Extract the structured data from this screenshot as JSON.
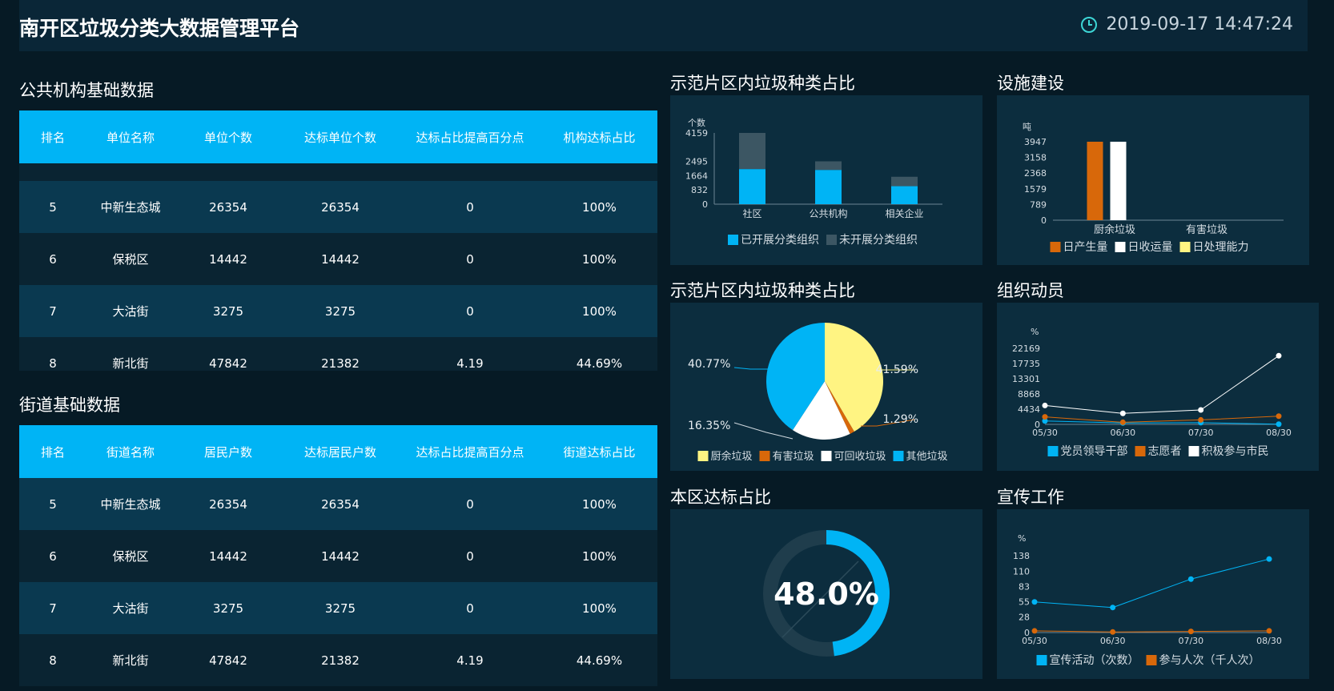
{
  "header": {
    "title": "南开区垃圾分类大数据管理平台",
    "datetime": "2019-09-17 14:47:24"
  },
  "org_table": {
    "title": "公共机构基础数据",
    "columns": [
      "排名",
      "单位名称",
      "单位个数",
      "达标单位个数",
      "达标占比提高百分点",
      "机构达标占比"
    ],
    "rows": [
      [
        "5",
        "中新生态城",
        "26354",
        "26354",
        "0",
        "100%"
      ],
      [
        "6",
        "保税区",
        "14442",
        "14442",
        "0",
        "100%"
      ],
      [
        "7",
        "大沽街",
        "3275",
        "3275",
        "0",
        "100%"
      ],
      [
        "8",
        "新北街",
        "47842",
        "21382",
        "4.19",
        "44.69%"
      ]
    ]
  },
  "street_table": {
    "title": "街道基础数据",
    "columns": [
      "排名",
      "街道名称",
      "居民户数",
      "达标居民户数",
      "达标占比提高百分点",
      "街道达标占比"
    ],
    "rows": [
      [
        "5",
        "中新生态城",
        "26354",
        "26354",
        "0",
        "100%"
      ],
      [
        "6",
        "保税区",
        "14442",
        "14442",
        "0",
        "100%"
      ],
      [
        "7",
        "大沽街",
        "3275",
        "3275",
        "0",
        "100%"
      ],
      [
        "8",
        "新北街",
        "47842",
        "21382",
        "4.19",
        "44.69%"
      ]
    ]
  },
  "panels": {
    "bar1_title": "示范片区内垃圾种类占比",
    "bar2_title": "设施建设",
    "pie_title": "示范片区内垃圾种类占比",
    "line1_title": "组织动员",
    "donut_title": "本区达标占比",
    "line2_title": "宣传工作"
  },
  "colors": {
    "cyan": "#00b4f5",
    "orange": "#d8680a",
    "white": "#ffffff",
    "yellow": "#fff482",
    "gray": "#3c5663"
  },
  "chart_data": [
    {
      "id": "bar1",
      "type": "bar",
      "categories": [
        "社区",
        "公共机构",
        "相关企业"
      ],
      "ylabel": "个数",
      "yticks": [
        "0",
        "832",
        "1664",
        "2495",
        "4159"
      ],
      "ylim": [
        0,
        4159
      ],
      "series": [
        {
          "name": "已开展分类组织",
          "values": [
            2050,
            2000,
            1050
          ]
        },
        {
          "name": "未开展分类组织",
          "values": [
            2109,
            500,
            550
          ]
        }
      ],
      "stacked": true
    },
    {
      "id": "bar2",
      "type": "bar",
      "categories": [
        "厨余垃圾",
        "有害垃圾"
      ],
      "ylabel": "吨",
      "yticks": [
        "0",
        "789",
        "1579",
        "2368",
        "3158",
        "3947"
      ],
      "ylim": [
        0,
        3947
      ],
      "series": [
        {
          "name": "日产生量",
          "values": [
            3947,
            0
          ]
        },
        {
          "name": "日收运量",
          "values": [
            3947,
            0
          ]
        },
        {
          "name": "日处理能力",
          "values": [
            0,
            0
          ]
        }
      ]
    },
    {
      "id": "pie",
      "type": "pie",
      "slices": [
        {
          "name": "厨余垃圾",
          "value": 41.59,
          "label": "41.59%"
        },
        {
          "name": "有害垃圾",
          "value": 1.29,
          "label": "1.29%"
        },
        {
          "name": "可回收垃圾",
          "value": 16.35,
          "label": "16.35%"
        },
        {
          "name": "其他垃圾",
          "value": 40.77,
          "label": "40.77%"
        }
      ]
    },
    {
      "id": "line1",
      "type": "line",
      "categories": [
        "05/30",
        "06/30",
        "07/30",
        "08/30"
      ],
      "ylabel": "%",
      "yticks": [
        "0",
        "4434",
        "8868",
        "13301",
        "17735",
        "22169"
      ],
      "ylim": [
        0,
        22169
      ],
      "series": [
        {
          "name": "党员领导干部",
          "values": [
            1000,
            400,
            500,
            50
          ]
        },
        {
          "name": "志愿者",
          "values": [
            2200,
            600,
            1300,
            2400
          ]
        },
        {
          "name": "积极参与市民",
          "values": [
            5500,
            3200,
            4200,
            20000
          ]
        }
      ]
    },
    {
      "id": "donut",
      "type": "pie",
      "value": 48.0,
      "label": "48.0%"
    },
    {
      "id": "line2",
      "type": "line",
      "categories": [
        "05/30",
        "06/30",
        "07/30",
        "08/30"
      ],
      "ylabel": "%",
      "yticks": [
        "0",
        "28",
        "55",
        "83",
        "110",
        "138"
      ],
      "ylim": [
        0,
        138
      ],
      "series": [
        {
          "name": "宣传活动（次数）",
          "values": [
            55,
            45,
            96,
            132
          ]
        },
        {
          "name": "参与人次（千人次）",
          "values": [
            3,
            1,
            2,
            3
          ]
        }
      ]
    }
  ]
}
